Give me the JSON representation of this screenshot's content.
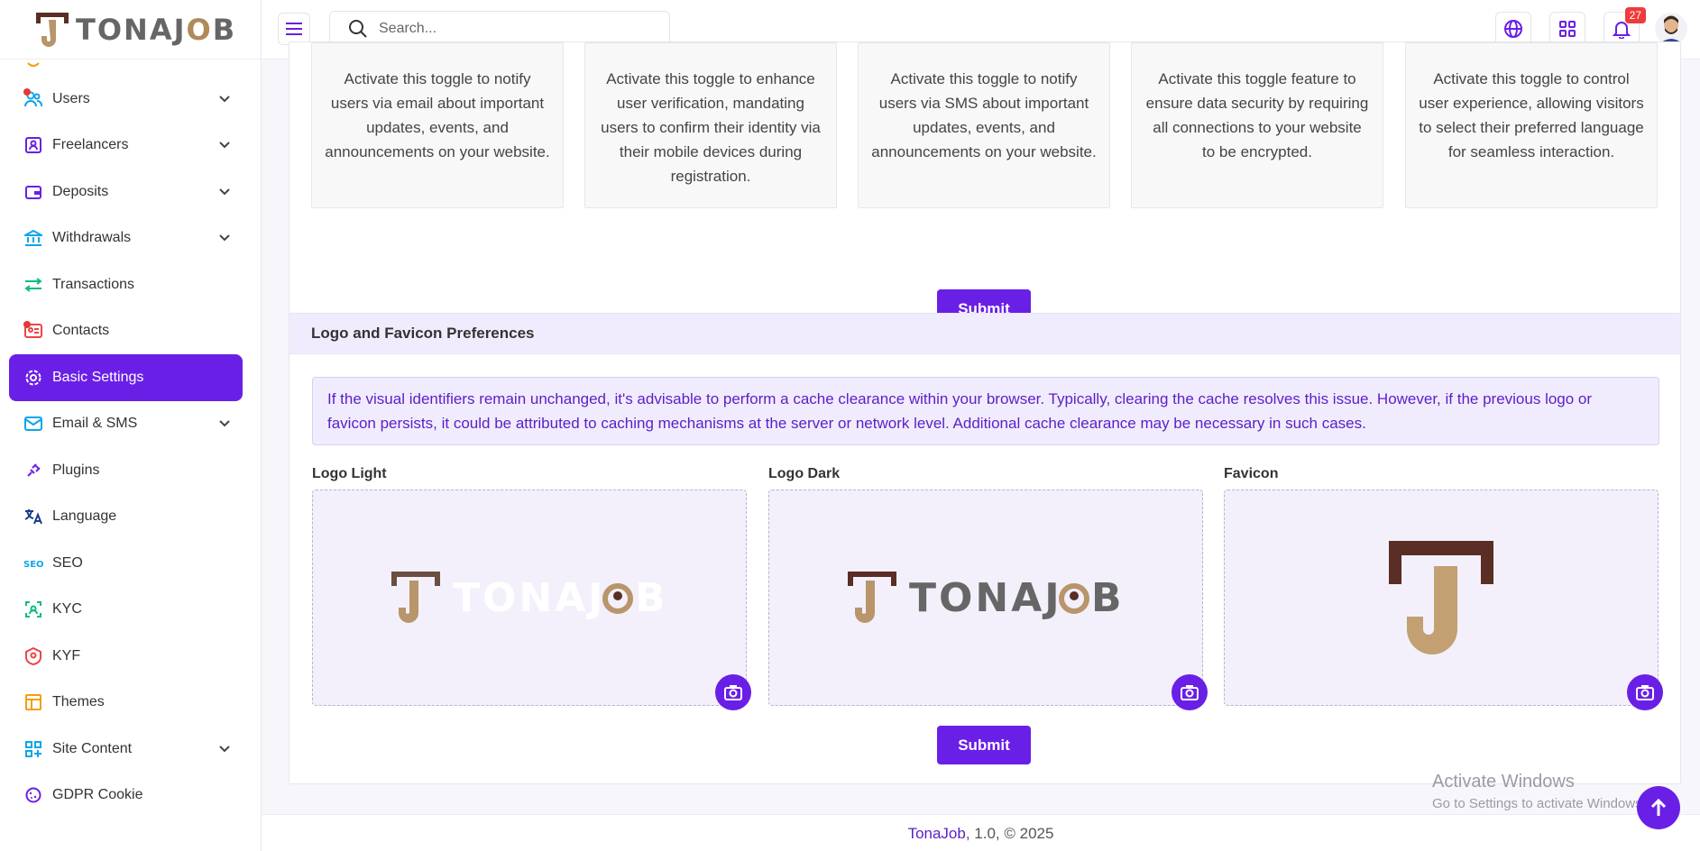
{
  "brand": {
    "name": "TONAJOB",
    "name_prefix": "TONAJ",
    "name_o": "O",
    "name_suffix": "B"
  },
  "search": {
    "placeholder": "Search..."
  },
  "topbar": {
    "notification_count": "27"
  },
  "sidebar": {
    "items": [
      {
        "label": "Users",
        "icon": "users-icon",
        "has_chevron": true,
        "dot": true
      },
      {
        "label": "Freelancers",
        "icon": "id-card-icon",
        "has_chevron": true,
        "dot": false
      },
      {
        "label": "Deposits",
        "icon": "wallet-icon",
        "has_chevron": true,
        "dot": false
      },
      {
        "label": "Withdrawals",
        "icon": "bank-icon",
        "has_chevron": true,
        "dot": false
      },
      {
        "label": "Transactions",
        "icon": "arrows-swap-icon",
        "has_chevron": false,
        "dot": false
      },
      {
        "label": "Contacts",
        "icon": "contact-card-icon",
        "has_chevron": false,
        "dot": true
      },
      {
        "label": "Basic Settings",
        "icon": "gear-icon",
        "has_chevron": false,
        "dot": false,
        "active": true
      },
      {
        "label": "Email & SMS",
        "icon": "mail-icon",
        "has_chevron": true,
        "dot": false
      },
      {
        "label": "Plugins",
        "icon": "plug-icon",
        "has_chevron": false,
        "dot": false
      },
      {
        "label": "Language",
        "icon": "translate-icon",
        "has_chevron": false,
        "dot": false
      },
      {
        "label": "SEO",
        "icon": "seo-icon",
        "has_chevron": false,
        "dot": false
      },
      {
        "label": "KYC",
        "icon": "face-scan-icon",
        "has_chevron": false,
        "dot": false
      },
      {
        "label": "KYF",
        "icon": "badge-user-icon",
        "has_chevron": false,
        "dot": false
      },
      {
        "label": "Themes",
        "icon": "layout-icon",
        "has_chevron": false,
        "dot": false
      },
      {
        "label": "Site Content",
        "icon": "grid-plus-icon",
        "has_chevron": true,
        "dot": false
      },
      {
        "label": "GDPR Cookie",
        "icon": "cookie-icon",
        "has_chevron": false,
        "dot": false
      }
    ]
  },
  "toggles": {
    "tiles": [
      "Activate this toggle to notify users via email about important updates, events, and announcements on your website.",
      "Activate this toggle to enhance user verification, mandating users to confirm their identity via their mobile devices during registration.",
      "Activate this toggle to notify users via SMS about important updates, events, and announcements on your website.",
      "Activate this toggle feature to ensure data security by requiring all connections to your website to be encrypted.",
      "Activate this toggle to control user experience, allowing visitors to select their preferred language for seamless interaction."
    ],
    "submit_label": "Submit"
  },
  "logo_section": {
    "title": "Logo and Favicon Preferences",
    "notice": "If the visual identifiers remain unchanged, it's advisable to perform a cache clearance within your browser. Typically, clearing the cache resolves this issue. However, if the previous logo or favicon persists, it could be attributed to caching mechanisms at the server or network level. Additional cache clearance may be necessary in such cases.",
    "uploaders": [
      {
        "label": "Logo Light"
      },
      {
        "label": "Logo Dark"
      },
      {
        "label": "Favicon"
      }
    ],
    "submit_label": "Submit"
  },
  "footer": {
    "brand": "TonaJob",
    "version_text": ", 1.0, © 2025"
  },
  "watermark": {
    "line1": "Activate Windows",
    "line2": "Go to Settings to activate Windows."
  },
  "colors": {
    "primary": "#6a1fe7",
    "brand_brown": "#5a2e24",
    "brand_gold": "#b8956a",
    "notice_bg": "#f1ecfd"
  }
}
